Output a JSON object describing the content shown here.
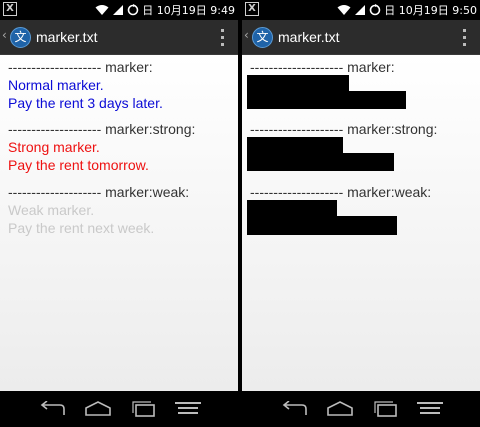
{
  "status": {
    "notification_glyph": "X",
    "left_screen_time": "日 10月19日 9:49",
    "right_screen_time": "日 10月19日 9:50"
  },
  "app": {
    "icon_glyph": "文",
    "title": "marker.txt",
    "back_glyph": "‹"
  },
  "sections": {
    "marker": {
      "header": "-------------------- marker:",
      "lines": [
        "Normal marker.",
        "Pay the rent 3 days later."
      ]
    },
    "marker_strong": {
      "header": "-------------------- marker:strong:",
      "lines": [
        "Strong marker.",
        "Pay the rent tomorrow."
      ]
    },
    "marker_weak": {
      "header": "-------------------- marker:weak:",
      "lines": [
        "Weak marker.",
        "Pay the rent next week."
      ]
    }
  },
  "colors": {
    "normal_marker": "#0b0bd6",
    "strong_marker": "#ee1111",
    "weak_marker": "#c9c9c9",
    "redaction": "#000000"
  },
  "icons": {
    "statusbar": [
      "notification-icon",
      "wifi-icon",
      "signal-icon",
      "sync-icon"
    ],
    "navbar": [
      "back-icon",
      "home-icon",
      "recent-apps-icon",
      "menu-icon"
    ]
  }
}
